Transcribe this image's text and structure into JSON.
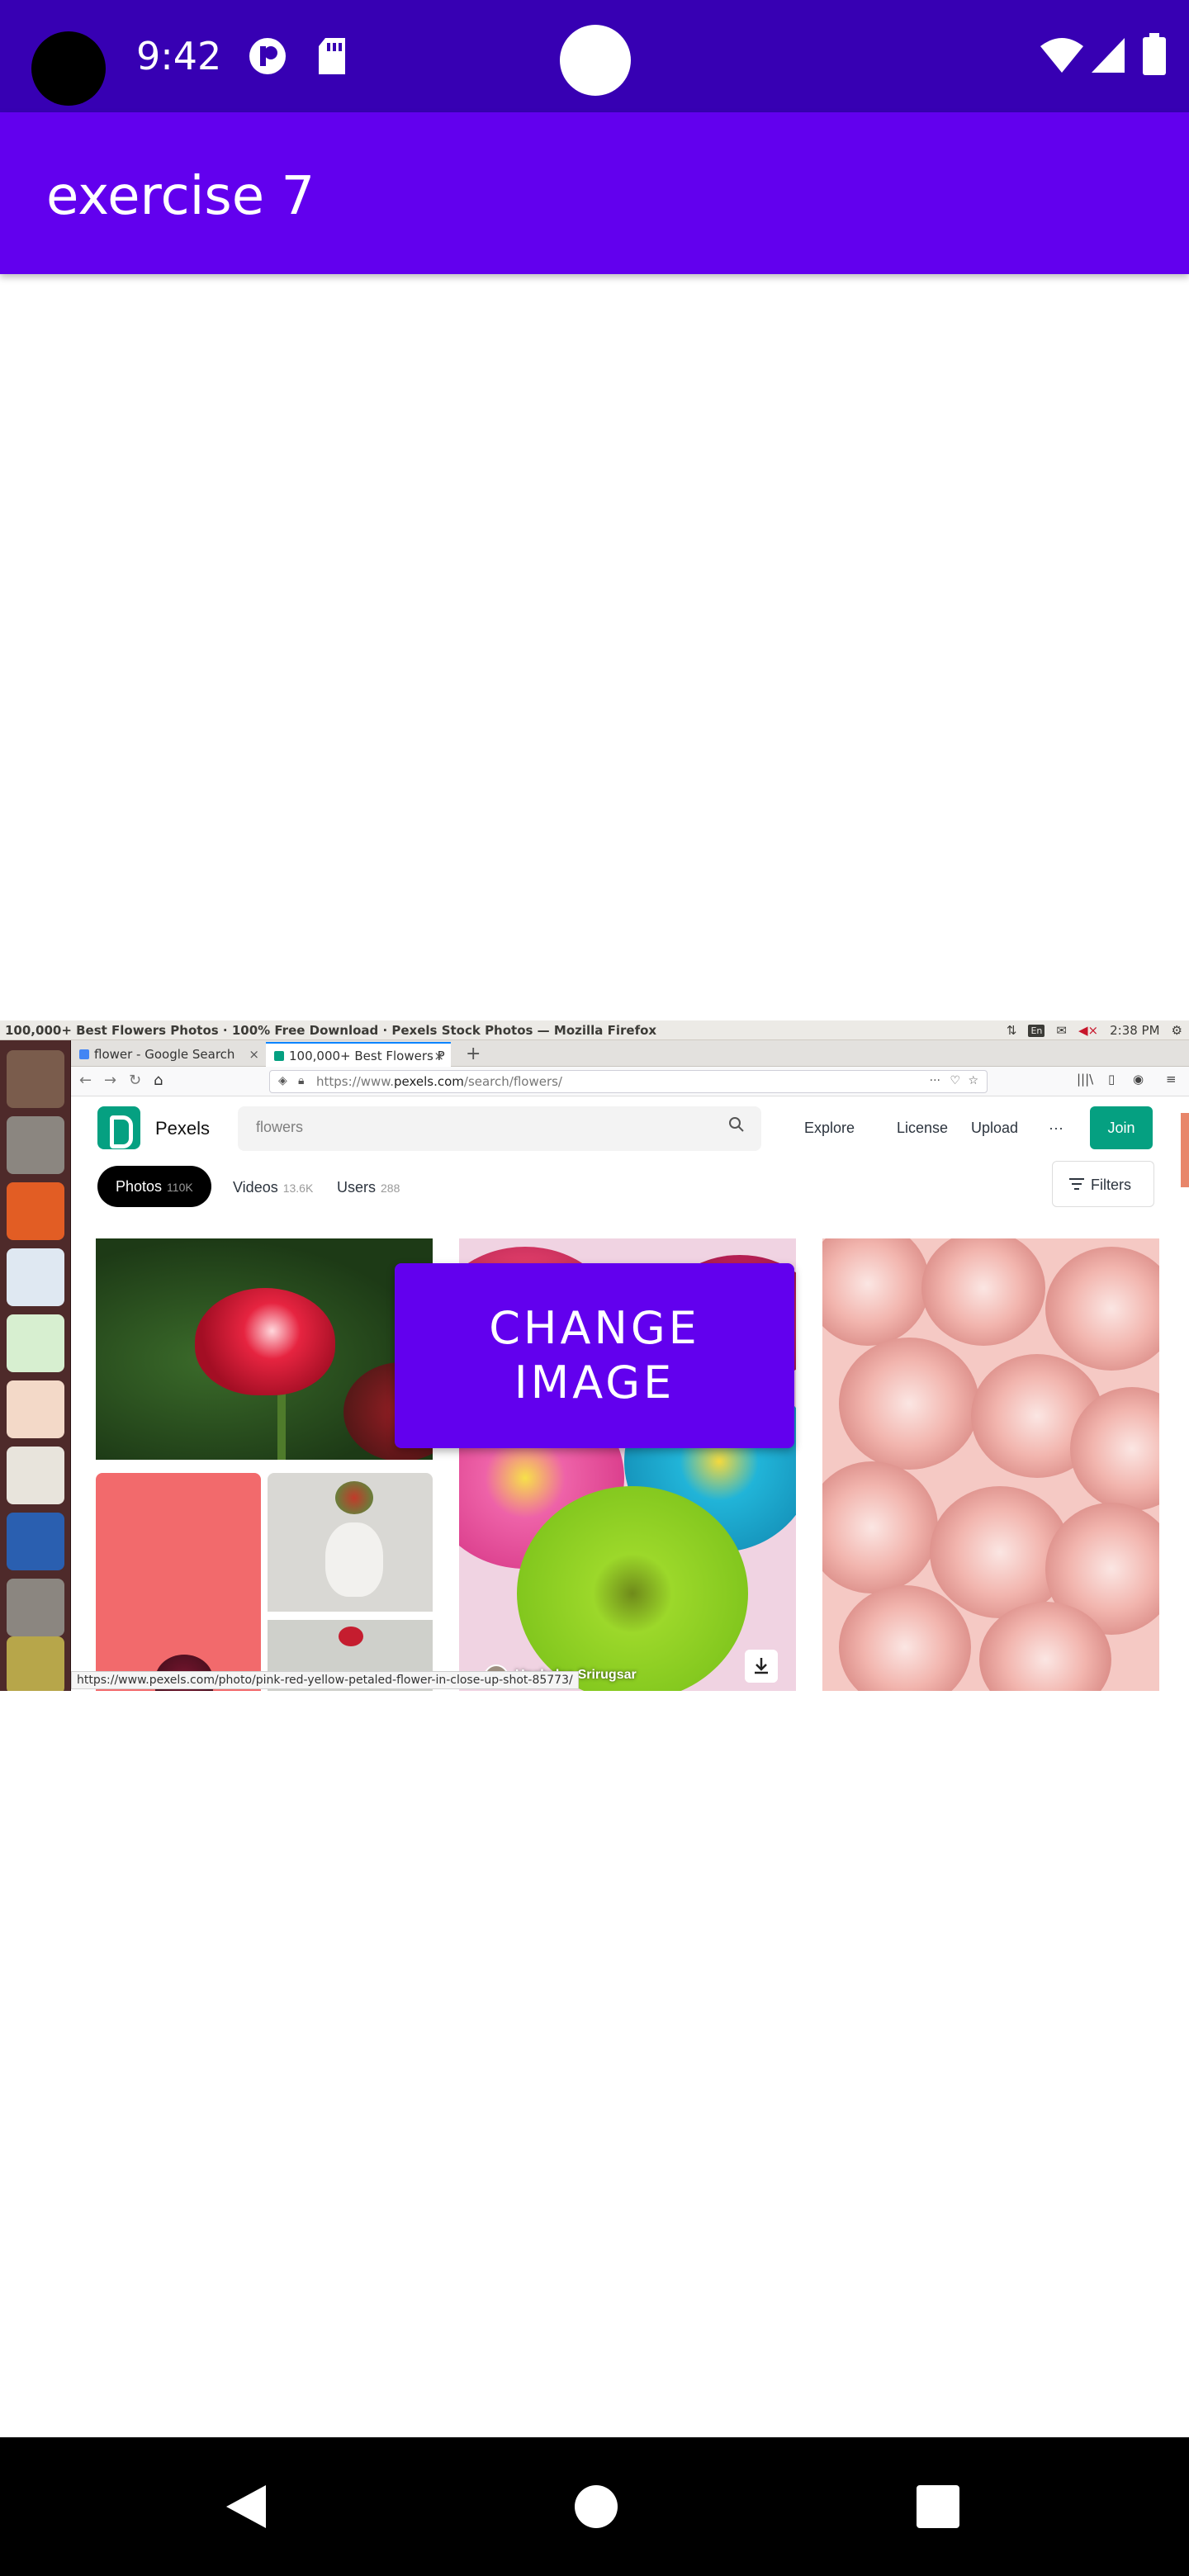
{
  "status_bar": {
    "time": "9:42"
  },
  "app_bar": {
    "title": "exercise 7"
  },
  "screenshot": {
    "window_title": "100,000+ Best Flowers Photos · 100% Free Download · Pexels Stock Photos — Mozilla Firefox",
    "tray": {
      "lang": "En",
      "time": "2:38 PM"
    },
    "tabs": [
      {
        "label": "flower - Google Search"
      },
      {
        "label": "100,000+ Best Flowers P"
      }
    ],
    "url": {
      "prefix": "https://www.",
      "host": "pexels.com",
      "path": "/search/flowers/"
    },
    "pexels": {
      "brand": "Pexels",
      "search_value": "flowers",
      "nav": [
        "Explore",
        "License",
        "Upload",
        "···"
      ],
      "join_label": "Join",
      "media_tabs": [
        {
          "label": "Photos",
          "count": "110K"
        },
        {
          "label": "Videos",
          "count": "13.6K"
        },
        {
          "label": "Users",
          "count": "288"
        }
      ],
      "filters_label": "Filters",
      "photographer": "Unchalee Srirugsar"
    },
    "status_url": "https://www.pexels.com/photo/pink-red-yellow-petaled-flower-in-close-up-shot-85773/"
  },
  "button": {
    "change_image": "CHANGE\nIMAGE"
  }
}
